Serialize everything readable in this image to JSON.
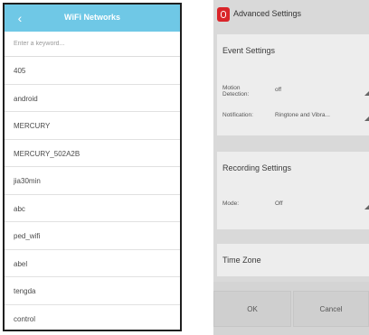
{
  "wifi": {
    "title": "WiFi Networks",
    "back_icon": "back-arrow-icon",
    "search_placeholder": "Enter a keyword...",
    "networks": [
      "405",
      "android",
      "MERCURY",
      "MERCURY_502A2B",
      "jia30min",
      "abc",
      "ped_wifi",
      "abel",
      "tengda",
      "control"
    ]
  },
  "settings": {
    "title": "Advanced Settings",
    "app_icon": "app-icon",
    "event": {
      "heading": "Event Settings",
      "motion_label": "Motion Detection:",
      "motion_value": "off",
      "notification_label": "Notification:",
      "notification_value": "Ringtone and Vibra..."
    },
    "recording": {
      "heading": "Recording Settings",
      "mode_label": "Mode:",
      "mode_value": "Off"
    },
    "timezone": {
      "heading": "Time Zone"
    },
    "buttons": {
      "ok": "OK",
      "cancel": "Cancel"
    },
    "accent_color": "#d9252a"
  },
  "colors": {
    "wifi_header": "#6fc8e6",
    "settings_bg": "#d9d9d9",
    "section_bg": "#ededed"
  }
}
